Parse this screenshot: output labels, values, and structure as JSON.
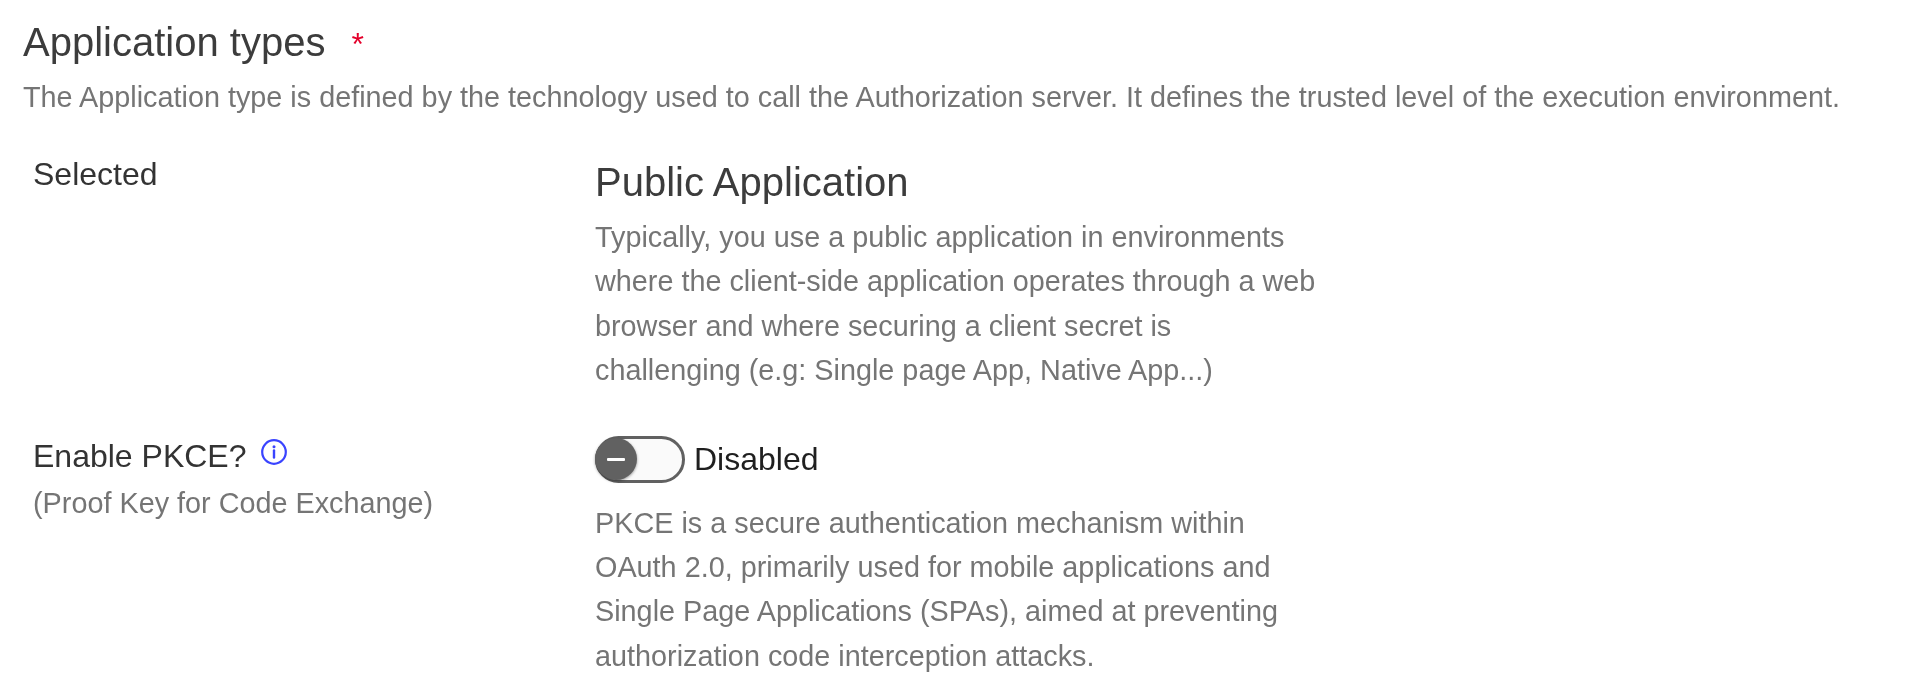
{
  "section": {
    "title": "Application types",
    "required_mark": "*",
    "description": "The Application type is defined by the technology used to call the Authorization server. It defines the trusted level of the execution environment."
  },
  "rows": [
    {
      "kind": "text",
      "label": "Selected",
      "heading": "Public Application",
      "description": "Typically, you use a public application in environments where the client-side application operates through a web browser and where securing a client secret is challenging (e.g: Single page App, Native App...)"
    },
    {
      "kind": "toggle",
      "label": "Enable PKCE?",
      "info_icon": true,
      "sublabel": "(Proof Key for Code Exchange)",
      "toggle": {
        "on": false,
        "label": "Disabled"
      },
      "description": "PKCE is a secure authentication mechanism within OAuth 2.0, primarily used for mobile applications and Single Page Applications (SPAs), aimed at preventing authorization code interception attacks."
    }
  ]
}
